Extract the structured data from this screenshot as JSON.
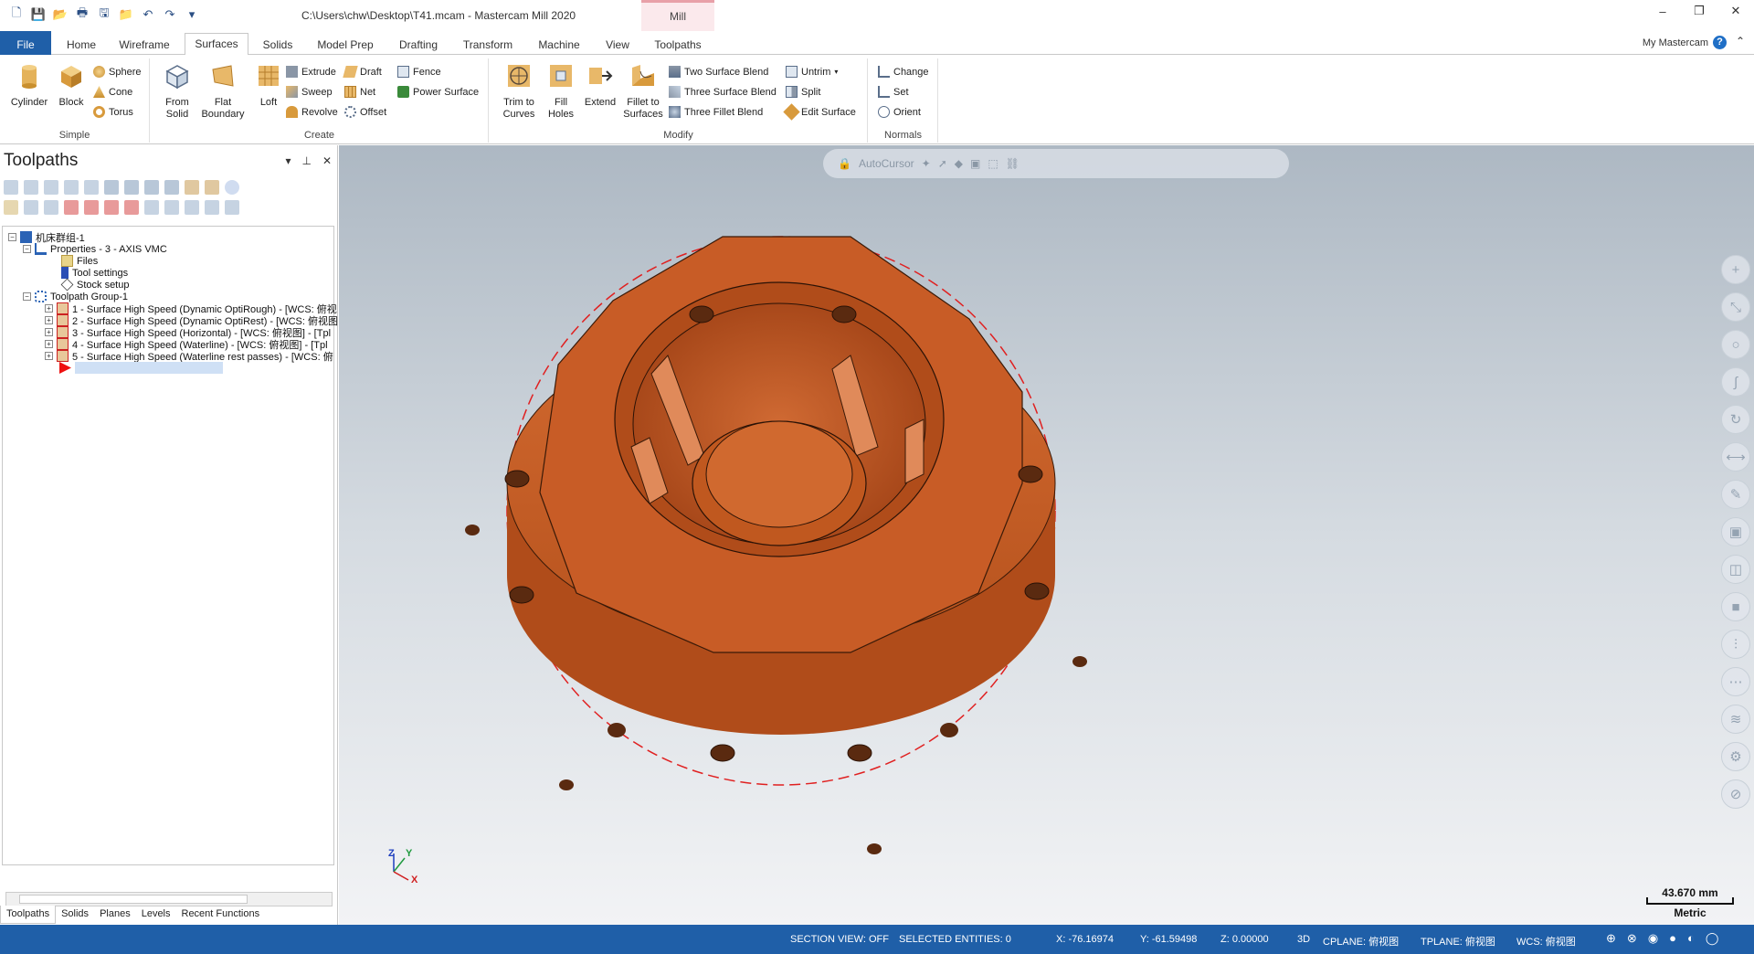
{
  "titlebar": {
    "title": "C:\\Users\\chw\\Desktop\\T41.mcam - Mastercam Mill 2020",
    "context_tab": "Mill"
  },
  "tabs": [
    "File",
    "Home",
    "Wireframe",
    "Surfaces",
    "Solids",
    "Model Prep",
    "Drafting",
    "Transform",
    "Machine",
    "View",
    "Toolpaths"
  ],
  "active_tab": "Surfaces",
  "my_mastercam": "My Mastercam",
  "ribbon": {
    "simple": {
      "label": "Simple",
      "cylinder": "Cylinder",
      "block": "Block",
      "sphere": "Sphere",
      "cone": "Cone",
      "torus": "Torus"
    },
    "create": {
      "label": "Create",
      "from_solid": [
        "From",
        "Solid"
      ],
      "flat_boundary": [
        "Flat",
        "Boundary"
      ],
      "loft": "Loft",
      "extrude": "Extrude",
      "sweep": "Sweep",
      "revolve": "Revolve",
      "draft": "Draft",
      "net": "Net",
      "offset": "Offset",
      "fence": "Fence",
      "power_surface": "Power Surface"
    },
    "modify": {
      "label": "Modify",
      "trim_to_curves": [
        "Trim to",
        "Curves"
      ],
      "fill_holes": [
        "Fill",
        "Holes"
      ],
      "extend": "Extend",
      "fillet_to_surfaces": [
        "Fillet to",
        "Surfaces"
      ],
      "two_surface_blend": "Two Surface Blend",
      "three_surface_blend": "Three Surface Blend",
      "three_fillet_blend": "Three Fillet Blend",
      "untrim": "Untrim",
      "split": "Split",
      "edit_surface": "Edit Surface"
    },
    "normals": {
      "label": "Normals",
      "change": "Change",
      "set": "Set",
      "orient": "Orient"
    }
  },
  "panel": {
    "title": "Toolpaths",
    "tree": {
      "root": "机床群组-1",
      "properties": "Properties - 3 - AXIS VMC",
      "files": "Files",
      "tool_settings": "Tool settings",
      "stock_setup": "Stock setup",
      "group": "Toolpath Group-1",
      "operations": [
        "1 - Surface High Speed (Dynamic OptiRough) - [WCS: 俯视",
        "2 - Surface High Speed (Dynamic OptiRest) - [WCS: 俯视图",
        "3 - Surface High Speed (Horizontal) - [WCS: 俯视图] - [Tpl",
        "4 - Surface High Speed (Waterline) - [WCS: 俯视图] - [Tpl",
        "5 - Surface High Speed (Waterline rest passes) - [WCS: 俯"
      ]
    },
    "bottom_tabs": [
      "Toolpaths",
      "Solids",
      "Planes",
      "Levels",
      "Recent Functions"
    ]
  },
  "viewport": {
    "autocursor": "AutoCursor",
    "scale_value": "43.670 mm",
    "scale_unit": "Metric",
    "axis_labels": {
      "x": "X",
      "y": "Y",
      "z": "Z"
    },
    "part_color": "#c8602e"
  },
  "statusbar": {
    "section_view": "SECTION VIEW: OFF",
    "selected": "SELECTED ENTITIES: 0",
    "x": "X:  -76.16974",
    "y": "Y:  -61.59498",
    "z": "Z:  0.00000",
    "mode": "3D",
    "cplane": "CPLANE: 俯视图",
    "tplane": "TPLANE: 俯视图",
    "wcs": "WCS: 俯视图"
  },
  "colors": {
    "accent": "#1f5fa8",
    "status_bar": "#1f5fa8"
  }
}
